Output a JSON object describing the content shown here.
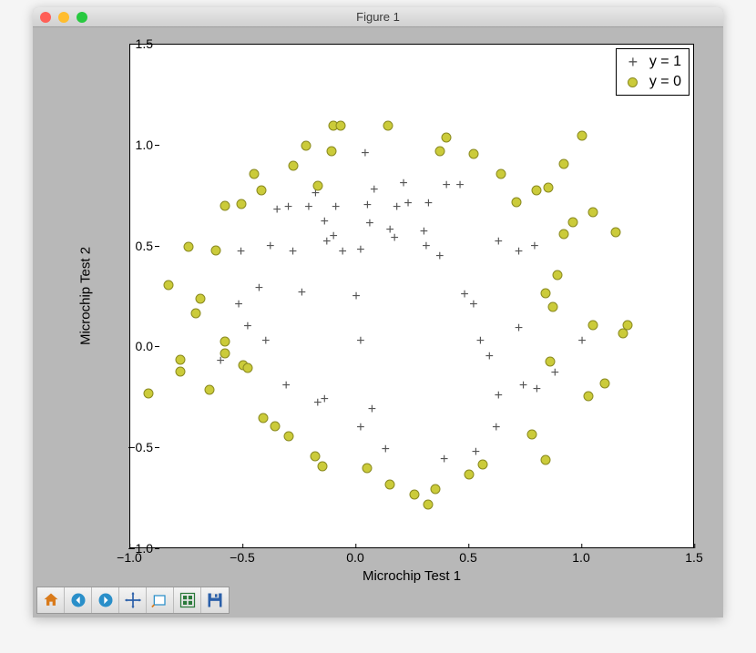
{
  "window": {
    "title": "Figure 1"
  },
  "toolbar": {
    "buttons": [
      {
        "id": "home",
        "label": "Home"
      },
      {
        "id": "back",
        "label": "Back"
      },
      {
        "id": "forward",
        "label": "Forward"
      },
      {
        "id": "pan",
        "label": "Pan"
      },
      {
        "id": "zoom",
        "label": "Zoom"
      },
      {
        "id": "subplots",
        "label": "Configure subplots"
      },
      {
        "id": "save",
        "label": "Save figure"
      }
    ]
  },
  "chart_data": {
    "type": "scatter",
    "xlabel": "Microchip Test 1",
    "ylabel": "Microchip Test 2",
    "xlim": [
      -1.0,
      1.5
    ],
    "ylim": [
      -1.0,
      1.5
    ],
    "xticks": [
      -1.0,
      -0.5,
      0.0,
      0.5,
      1.0,
      1.5
    ],
    "yticks": [
      -1.0,
      -0.5,
      0.0,
      0.5,
      1.0,
      1.5
    ],
    "xtick_labels": [
      "−1.0",
      "−0.5",
      "0.0",
      "0.5",
      "1.0",
      "1.5"
    ],
    "ytick_labels": [
      "−1.0",
      "−0.5",
      "0.0",
      "0.5",
      "1.0",
      "1.5"
    ],
    "legend": [
      {
        "label": "y = 1",
        "marker": "plus",
        "color": "#555555"
      },
      {
        "label": "y = 0",
        "marker": "circle",
        "color": "#cbcb3a"
      }
    ],
    "series": [
      {
        "name": "y = 1",
        "marker": "plus",
        "points": [
          [
            0.05,
            0.7
          ],
          [
            -0.09,
            0.69
          ],
          [
            -0.21,
            0.69
          ],
          [
            -0.38,
            0.5
          ],
          [
            -0.51,
            0.47
          ],
          [
            -0.52,
            0.21
          ],
          [
            -0.4,
            0.03
          ],
          [
            -0.31,
            -0.19
          ],
          [
            0.02,
            -0.4
          ],
          [
            0.13,
            -0.51
          ],
          [
            0.39,
            -0.56
          ],
          [
            0.53,
            -0.52
          ],
          [
            0.63,
            -0.24
          ],
          [
            0.74,
            -0.19
          ],
          [
            0.55,
            0.03
          ],
          [
            0.72,
            0.09
          ],
          [
            0.48,
            0.26
          ],
          [
            0.52,
            0.21
          ],
          [
            0.63,
            0.52
          ],
          [
            0.79,
            0.5
          ],
          [
            0.72,
            0.47
          ],
          [
            0.59,
            -0.05
          ],
          [
            0.88,
            -0.13
          ],
          [
            1.0,
            0.03
          ],
          [
            -0.24,
            0.27
          ],
          [
            -0.06,
            0.47
          ],
          [
            -0.28,
            0.47
          ],
          [
            -0.43,
            0.29
          ],
          [
            0.15,
            0.58
          ],
          [
            0.17,
            0.54
          ],
          [
            -0.1,
            0.55
          ],
          [
            -0.48,
            0.1
          ],
          [
            -0.6,
            -0.07
          ],
          [
            0.62,
            -0.4
          ],
          [
            0.8,
            -0.21
          ],
          [
            0.31,
            0.5
          ],
          [
            0.3,
            0.57
          ],
          [
            -0.35,
            0.68
          ],
          [
            -0.3,
            0.69
          ],
          [
            -0.18,
            0.76
          ],
          [
            0.46,
            0.8
          ],
          [
            0.21,
            0.81
          ],
          [
            -0.14,
            0.62
          ],
          [
            -0.13,
            0.52
          ],
          [
            0.18,
            0.69
          ],
          [
            0.0,
            0.25
          ],
          [
            -0.14,
            -0.26
          ],
          [
            0.06,
            0.61
          ],
          [
            0.37,
            0.45
          ],
          [
            0.04,
            0.96
          ],
          [
            0.4,
            0.8
          ],
          [
            0.32,
            0.71
          ],
          [
            0.23,
            0.71
          ],
          [
            0.02,
            0.48
          ],
          [
            0.08,
            0.78
          ],
          [
            0.02,
            0.03
          ],
          [
            -0.17,
            -0.28
          ],
          [
            0.07,
            -0.31
          ]
        ]
      },
      {
        "name": "y = 0",
        "marker": "circle",
        "points": [
          [
            -0.58,
            -0.03
          ],
          [
            -0.83,
            0.31
          ],
          [
            -0.78,
            -0.12
          ],
          [
            -0.78,
            -0.06
          ],
          [
            -0.62,
            0.48
          ],
          [
            -0.42,
            0.78
          ],
          [
            -0.17,
            0.8
          ],
          [
            -0.11,
            0.97
          ],
          [
            -0.1,
            1.1
          ],
          [
            0.37,
            0.97
          ],
          [
            0.8,
            0.78
          ],
          [
            0.92,
            0.91
          ],
          [
            1.0,
            1.05
          ],
          [
            1.15,
            0.57
          ],
          [
            1.18,
            0.07
          ],
          [
            1.2,
            0.11
          ],
          [
            1.1,
            -0.18
          ],
          [
            1.03,
            -0.24
          ],
          [
            0.78,
            -0.43
          ],
          [
            0.56,
            -0.58
          ],
          [
            0.32,
            -0.78
          ],
          [
            0.05,
            -0.6
          ],
          [
            -0.15,
            -0.59
          ],
          [
            -0.18,
            -0.54
          ],
          [
            -0.3,
            -0.44
          ],
          [
            -0.36,
            -0.39
          ],
          [
            -0.41,
            -0.35
          ],
          [
            -0.45,
            0.86
          ],
          [
            -0.51,
            0.71
          ],
          [
            -0.22,
            1.0
          ],
          [
            -0.07,
            1.1
          ],
          [
            0.14,
            1.1
          ],
          [
            0.4,
            1.04
          ],
          [
            0.52,
            0.96
          ],
          [
            0.64,
            0.86
          ],
          [
            0.71,
            0.72
          ],
          [
            0.85,
            0.79
          ],
          [
            0.92,
            0.56
          ],
          [
            0.96,
            0.62
          ],
          [
            1.05,
            0.67
          ],
          [
            0.89,
            0.36
          ],
          [
            1.05,
            0.11
          ],
          [
            0.84,
            0.27
          ],
          [
            0.5,
            -0.63
          ],
          [
            0.15,
            -0.68
          ],
          [
            -0.58,
            0.03
          ],
          [
            -0.5,
            -0.09
          ],
          [
            -0.58,
            0.7
          ],
          [
            -0.74,
            0.5
          ],
          [
            -0.69,
            0.24
          ],
          [
            -0.71,
            0.17
          ],
          [
            -0.65,
            -0.21
          ],
          [
            -0.92,
            -0.23
          ],
          [
            -0.48,
            -0.1
          ],
          [
            0.26,
            -0.73
          ],
          [
            0.35,
            -0.7
          ],
          [
            -0.28,
            0.9
          ],
          [
            0.86,
            -0.07
          ],
          [
            0.87,
            0.2
          ],
          [
            0.84,
            -0.56
          ]
        ]
      }
    ]
  }
}
